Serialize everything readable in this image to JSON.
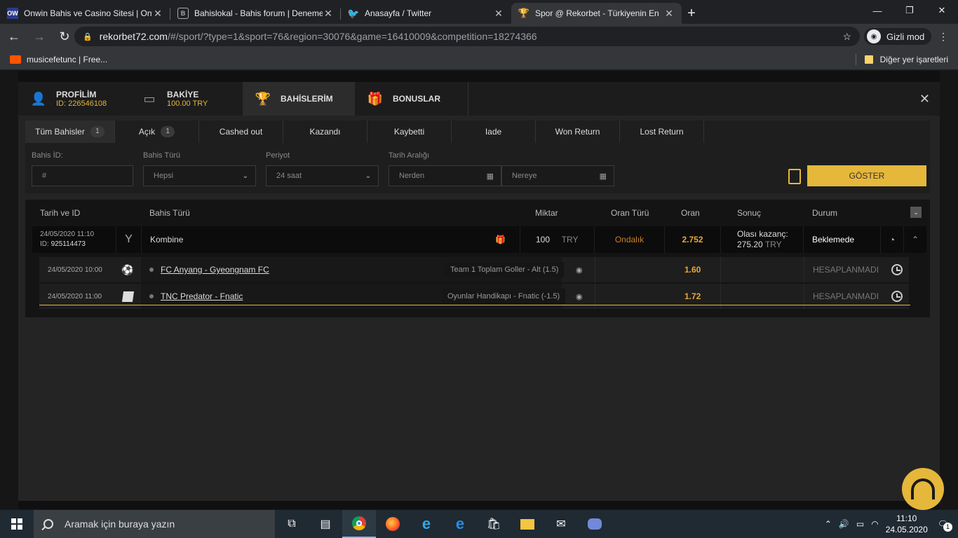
{
  "browser": {
    "tabs": [
      {
        "title": "Onwin Bahis ve Casino Sitesi | Onwin",
        "favicon": "OW"
      },
      {
        "title": "Bahislokal - Bahis forum | Deneme",
        "favicon": "B"
      },
      {
        "title": "Anasayfa / Twitter",
        "favicon": "twitter-bird"
      },
      {
        "title": "Spor @ Rekorbet - Türkiyenin En",
        "favicon": "trophy"
      }
    ],
    "url_domain": "rekorbet72.com",
    "url_path": "/#/sport/?type=1&sport=76&region=30076&game=16410009&competition=18274366",
    "incognito_label": "Gizli mod",
    "bookmark": "musicefetunc | Free...",
    "other_bookmarks": "Diğer yer işaretleri"
  },
  "modal": {
    "tabs": [
      {
        "title": "PROFİLİM",
        "sub": "ID: 226546108",
        "icon": "user-icon"
      },
      {
        "title": "BAKİYE",
        "sub": "100.00 TRY",
        "icon": "wallet-icon"
      },
      {
        "title": "BAHİSLERİM",
        "sub": "",
        "icon": "trophy-icon"
      },
      {
        "title": "BONUSLAR",
        "sub": "",
        "icon": "gift-icon"
      }
    ],
    "close": "✕"
  },
  "filter_tabs": [
    {
      "label": "Tüm Bahisler",
      "count": "1"
    },
    {
      "label": "Açık",
      "count": "1"
    },
    {
      "label": "Cashed out",
      "count": ""
    },
    {
      "label": "Kazandı",
      "count": ""
    },
    {
      "label": "Kaybetti",
      "count": ""
    },
    {
      "label": "Iade",
      "count": ""
    },
    {
      "label": "Won Return",
      "count": ""
    },
    {
      "label": "Lost Return",
      "count": ""
    }
  ],
  "filters": {
    "bet_id_label": "Bahis İD:",
    "bet_id_placeholder": "#",
    "bet_type_label": "Bahis Türü",
    "bet_type_value": "Hepsi",
    "period_label": "Periyot",
    "period_value": "24 saat",
    "date_range_label": "Tarih Aralığı",
    "from_placeholder": "Nerden",
    "to_placeholder": "Nereye",
    "show_button": "GÖSTER"
  },
  "table": {
    "headers": {
      "date_id": "Tarih ve ID",
      "bet_type": "Bahis Türü",
      "amount": "Miktar",
      "odds_type": "Oran Türü",
      "odds": "Oran",
      "result": "Sonuç",
      "status": "Durum"
    },
    "bet": {
      "date": "24/05/2020 11:10",
      "id_label": "ID:",
      "id": "925114473",
      "type": "Kombine",
      "amount": "100",
      "currency": "TRY",
      "odds_type": "Ondalık",
      "odds": "2.752",
      "potential_label": "Olası kazanç:",
      "potential_value": "275.20",
      "potential_currency": "TRY",
      "status": "Beklemede"
    },
    "selections": [
      {
        "date": "24/05/2020 10:00",
        "sport_icon": "football-icon",
        "event": "FC Anyang - Gyeongnam FC",
        "market": "Team 1 Toplam Goller - Alt (1.5)",
        "odds": "1.60",
        "status": "HESAPLANMADI"
      },
      {
        "date": "24/05/2020 11:00",
        "sport_icon": "dota-icon",
        "event": "TNC Predator - Fnatic",
        "market": "Oyunlar Handikapı - Fnatic (-1.5)",
        "odds": "1.72",
        "status": "HESAPLANMADI"
      }
    ]
  },
  "taskbar": {
    "search_placeholder": "Aramak için buraya yazın",
    "time": "11:10",
    "date": "24.05.2020",
    "notifications": "1"
  },
  "colors": {
    "accent": "#e5b73b",
    "odds": "#e5a83b"
  }
}
